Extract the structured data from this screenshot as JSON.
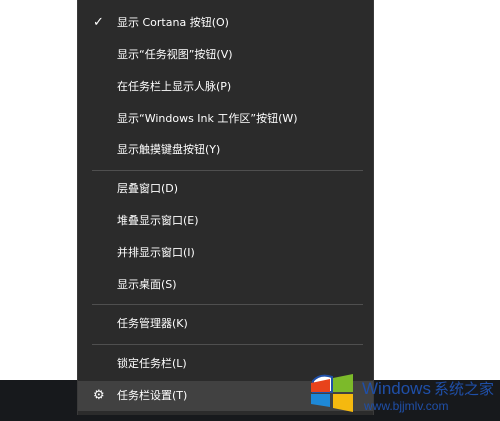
{
  "menu": {
    "items": [
      {
        "label": "显示 Cortana 按钮(O)",
        "checked": true
      },
      {
        "label": "显示“任务视图”按钮(V)"
      },
      {
        "label": "在任务栏上显示人脉(P)"
      },
      {
        "label": "显示“Windows Ink 工作区”按钮(W)"
      },
      {
        "label": "显示触摸键盘按钮(Y)"
      },
      {
        "label": "层叠窗口(D)"
      },
      {
        "label": "堆叠显示窗口(E)"
      },
      {
        "label": "并排显示窗口(I)"
      },
      {
        "label": "显示桌面(S)"
      },
      {
        "label": "任务管理器(K)"
      },
      {
        "label": "锁定任务栏(L)"
      },
      {
        "label": "任务栏设置(T)",
        "icon": "gear-icon",
        "highlighted": true
      }
    ]
  },
  "watermark": {
    "brand": "Windows",
    "suffix": "系统之家",
    "url": "www.bjjmlv.com"
  },
  "colors": {
    "menu_bg": "#2b2b2b",
    "menu_hover": "#414141",
    "separator": "#4f4f4f",
    "taskbar": "#17191c",
    "watermark_blue": "#1f4fa8"
  }
}
